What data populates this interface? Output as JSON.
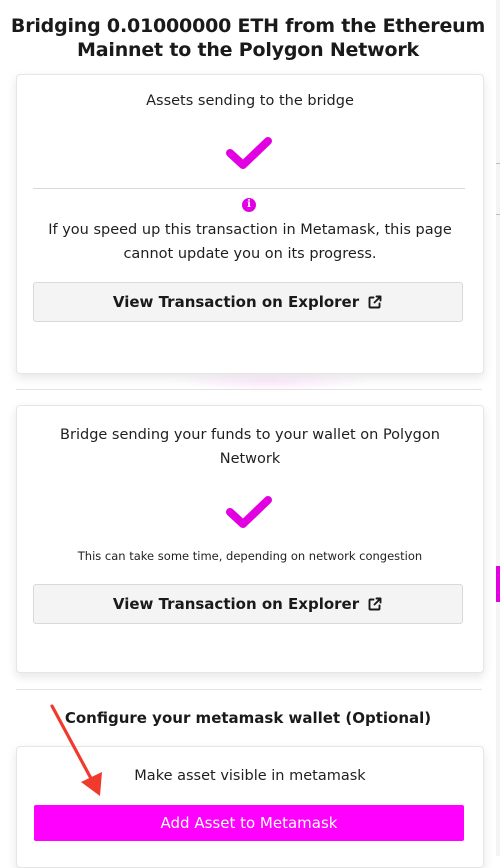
{
  "modal": {
    "title": "Bridging 0.01000000 ETH from the Ethereum Mainnet to the Polygon Network"
  },
  "steps": [
    {
      "heading": "Assets sending to the bridge",
      "status_icon": "checkmark-icon",
      "info_icon": "info-icon",
      "notice": "If you speed up this transaction in Metamask, this page cannot update you on its progress.",
      "button_label": "View Transaction on Explorer",
      "button_icon": "external-link-icon"
    },
    {
      "heading": "Bridge sending your funds to your wallet on Polygon Network",
      "status_icon": "checkmark-icon",
      "note": "This can take some time, depending on network congestion",
      "button_label": "View Transaction on Explorer",
      "button_icon": "external-link-icon"
    }
  ],
  "configure": {
    "title": "Configure your metamask wallet (Optional)",
    "description": "Make asset visible in metamask",
    "button_label": "Add Asset to Metamask"
  },
  "colors": {
    "accent": "#e200e2",
    "primary_button": "#ff00ff",
    "annotation_arrow": "#f03a2e"
  }
}
